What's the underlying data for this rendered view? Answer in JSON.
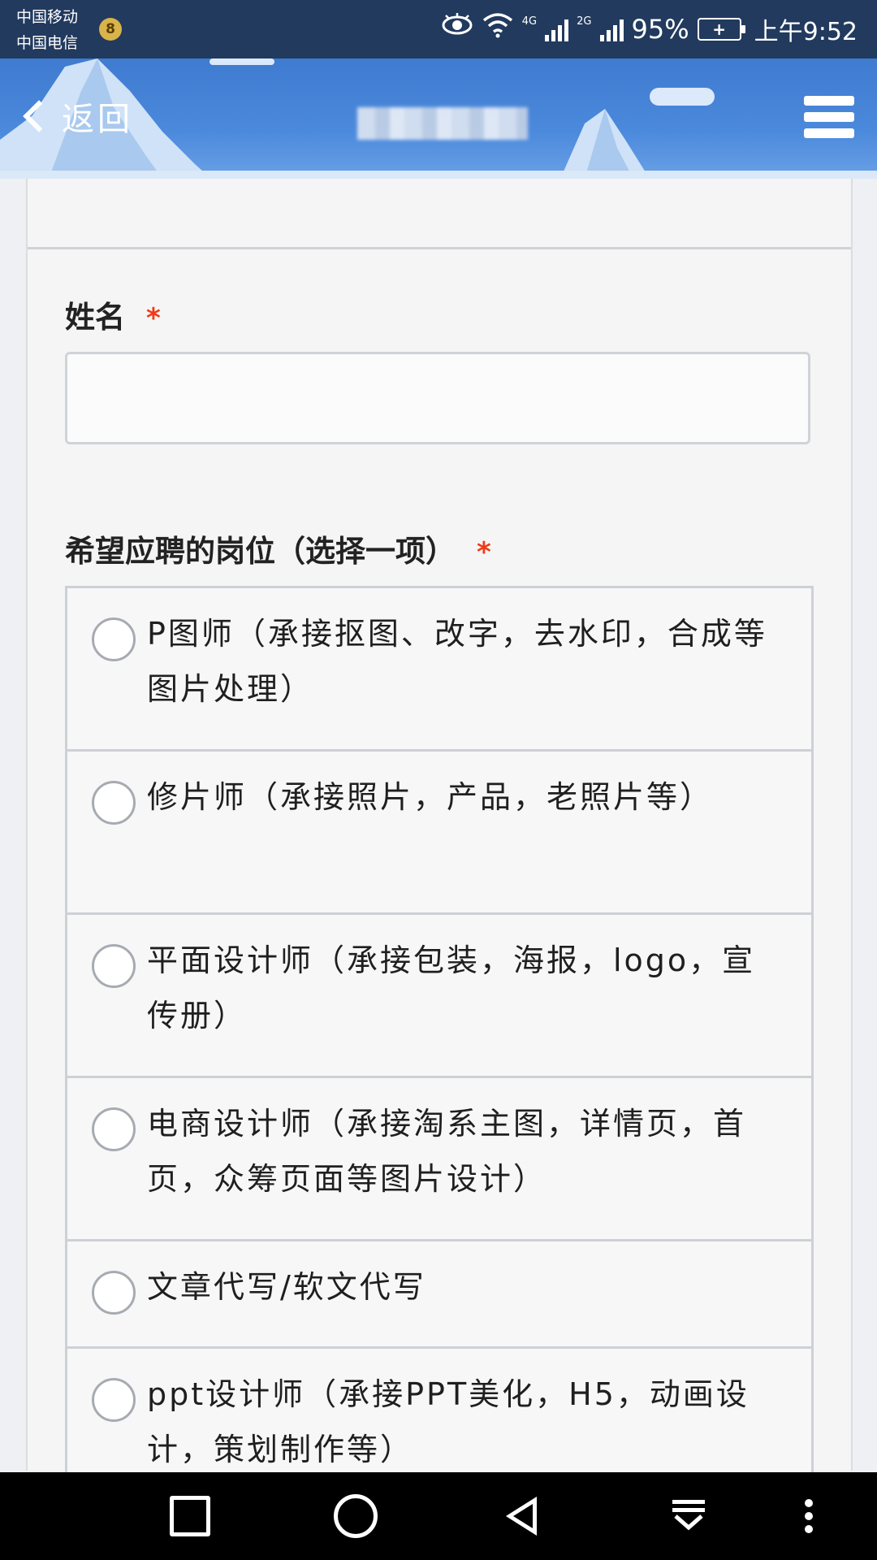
{
  "status_bar": {
    "carrier1": "中国移动",
    "carrier2": "中国电信",
    "sim_badge": "8",
    "net1": "4G",
    "net2": "2G",
    "battery_percent": "95%",
    "battery_glyph": "+",
    "time": "上午9:52"
  },
  "header": {
    "back_label": "返回",
    "title": "",
    "accent": "#4b89dc"
  },
  "form": {
    "name_label": "姓名",
    "position_label": "希望应聘的岗位（选择一项）",
    "required_mark": "*",
    "options": [
      "P图师（承接抠图、改字，去水印，合成等图片处理）",
      "修片师（承接照片，产品，老照片等）",
      "平面设计师（承接包装，海报，logo，宣传册）",
      "电商设计师（承接淘系主图，详情页，首页，众筹页面等图片设计）",
      "文章代写/软文代写",
      "ppt设计师（承接PPT美化，H5，动画设计，策划制作等）"
    ]
  },
  "colors": {
    "required": "#f03a17",
    "status_bar": "#223a5e"
  }
}
